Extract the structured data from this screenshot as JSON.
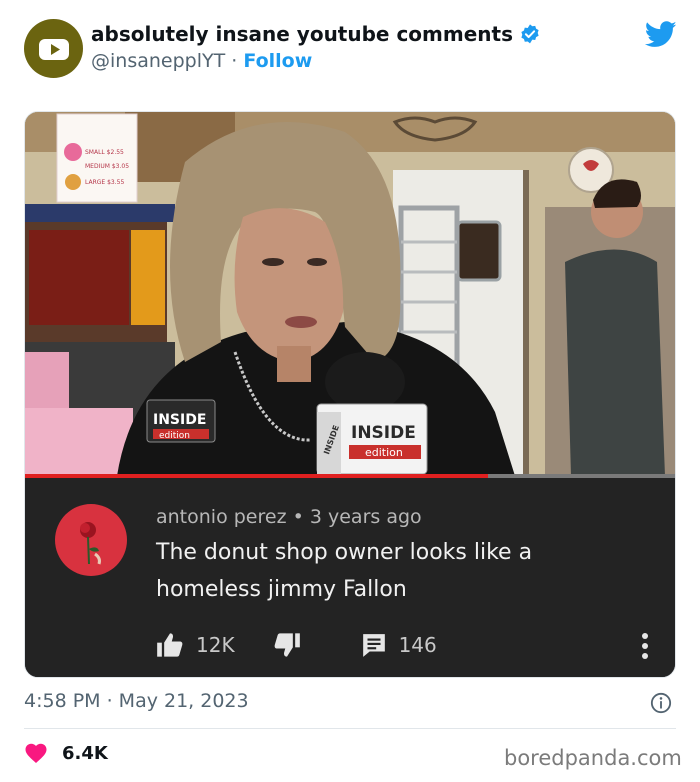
{
  "tweet": {
    "display_name": "absolutely insane youtube comments",
    "handle": "@insanepplYT",
    "separator": "·",
    "follow_label": "Follow",
    "timestamp": "4:58 PM · May 21, 2023",
    "likes": "6.4K",
    "icons": [
      "verified-badge-icon",
      "twitter-bird-icon",
      "info-icon",
      "heart-icon"
    ],
    "colors": {
      "accent": "#1d9bf0",
      "like": "#f91880",
      "avatar": "#6b6410"
    }
  },
  "media": {
    "scene": {
      "menu_sign": [
        "SMALL $2.55",
        "MEDIUM $3.05",
        "LARGE $3.55"
      ],
      "logo_text": "INSIDE",
      "logo_sub": "edition",
      "mic_text": "INSIDE",
      "mic_sub": "edition",
      "mic_side": "INSIDE"
    },
    "video_progress": 0.71,
    "comment": {
      "author": "antonio perez",
      "dot": "•",
      "age": "3 years ago",
      "text": "The donut shop owner looks like a homeless jimmy Fallon",
      "likes": "12K",
      "replies": "146",
      "icons": [
        "thumbs-up-icon",
        "thumbs-down-icon",
        "reply-icon",
        "more-vert-icon"
      ]
    }
  },
  "watermark": "boredpanda.com"
}
